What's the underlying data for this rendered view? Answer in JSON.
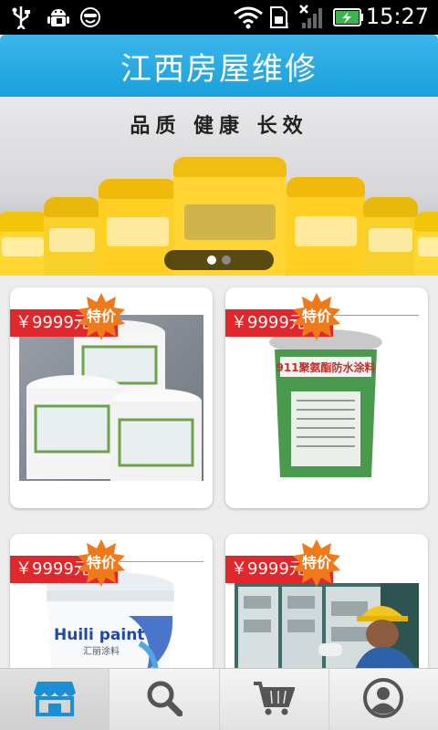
{
  "status_bar": {
    "time": "15:27",
    "icons": [
      "usb-icon",
      "android-debug-icon",
      "smiley-icon",
      "wifi-icon",
      "sim-icon",
      "no-signal-icon",
      "battery-charging-icon"
    ]
  },
  "header": {
    "title": "江西房屋维修"
  },
  "banner": {
    "slogan": "品质  健康  长效",
    "slide_count": 2,
    "active_slide": 1
  },
  "products": [
    {
      "price": "￥9999元",
      "badge": "特价"
    },
    {
      "price": "￥9999元",
      "badge": "特价",
      "product_label": "911聚氨酯防水涂料"
    },
    {
      "price": "￥9999元",
      "badge": "特价",
      "product_label": "Huili paint"
    },
    {
      "price": "￥9999元",
      "badge": "特价"
    }
  ],
  "bottom_nav": {
    "items": [
      {
        "icon": "store-icon",
        "active": true
      },
      {
        "icon": "search-icon",
        "active": false
      },
      {
        "icon": "cart-icon",
        "active": false
      },
      {
        "icon": "user-icon",
        "active": false
      }
    ]
  },
  "colors": {
    "header_blue": "#1aa0dc",
    "price_red": "#e0272b",
    "badge_orange": "#f07a1a",
    "nav_active_icon": "#1a8fd6",
    "nav_icon": "#555555"
  }
}
